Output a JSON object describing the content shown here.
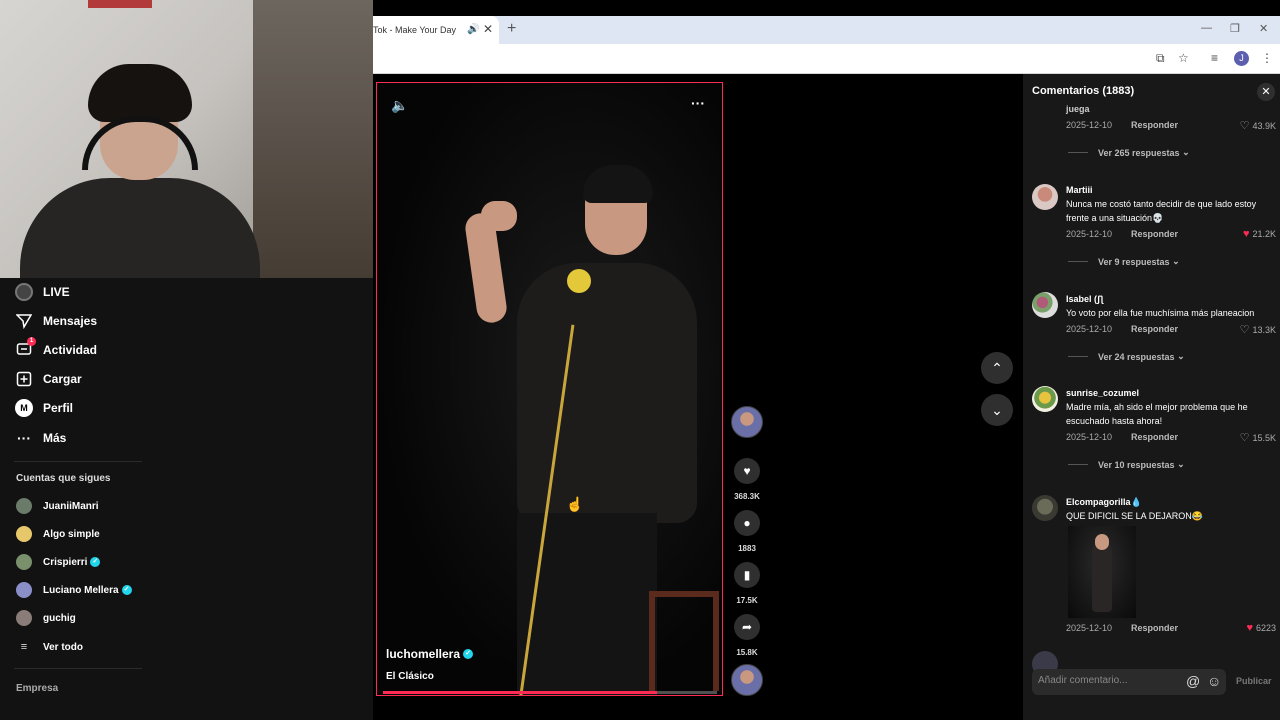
{
  "browser": {
    "tab_title": "Tok - Make Your Day",
    "profile_initial": "J"
  },
  "sidebar": {
    "items": [
      {
        "label": "LIVE",
        "icon": "live-icon"
      },
      {
        "label": "Mensajes",
        "icon": "paper-plane-icon"
      },
      {
        "label": "Actividad",
        "icon": "inbox-icon",
        "badge": "1"
      },
      {
        "label": "Cargar",
        "icon": "upload-icon"
      },
      {
        "label": "Perfil",
        "icon": "profile-icon"
      },
      {
        "label": "Más",
        "icon": "more-icon"
      }
    ],
    "following_title": "Cuentas que sigues",
    "following": [
      {
        "name": "JuaniiManri",
        "verified": false,
        "color": "#6b7b6a"
      },
      {
        "name": "Algo simple",
        "verified": false,
        "color": "#e6c86a"
      },
      {
        "name": "Crispierri",
        "verified": true,
        "color": "#7a8f6c"
      },
      {
        "name": "Luciano Mellera",
        "verified": true,
        "color": "#8b8fc8"
      },
      {
        "name": "guchig",
        "verified": false,
        "color": "#8a7c78"
      }
    ],
    "see_all": "Ver todo",
    "footer_label": "Empresa"
  },
  "video": {
    "username": "luchomellera",
    "description": "El Clásico",
    "progress": 0.82
  },
  "actions": {
    "likes": "368.3K",
    "comments": "1883",
    "saves": "17.5K",
    "shares": "15.8K"
  },
  "comments_panel": {
    "title": "Comentarios",
    "count": "(1883)",
    "top_partial_name": "juega",
    "comments": [
      {
        "name": "",
        "text": "",
        "date": "2025-12-10",
        "reply": "Responder",
        "likes": "43.9K",
        "liked": false,
        "more": "Ver 265 respuestas"
      },
      {
        "name": "Martiii",
        "text": "Nunca me costó tanto decidir de que lado estoy frente a una situación💀",
        "date": "2025-12-10",
        "reply": "Responder",
        "likes": "21.2K",
        "liked": true,
        "more": "Ver 9 respuestas"
      },
      {
        "name": "Isabel (ʃƪ",
        "text": "Yo voto por ella fue muchísima más planeacion",
        "date": "2025-12-10",
        "reply": "Responder",
        "likes": "13.3K",
        "liked": false,
        "more": "Ver 24 respuestas"
      },
      {
        "name": "sunrise_cozumel",
        "text": "Madre mía, ah sido el mejor problema que he escuchado hasta ahora!",
        "date": "2025-12-10",
        "reply": "Responder",
        "likes": "15.5K",
        "liked": false,
        "more": "Ver 10 respuestas"
      },
      {
        "name": "Elcompagorilla💧",
        "text": "QUE DIFICIL SE LA DEJARON😂",
        "date": "2025-12-10",
        "reply": "Responder",
        "likes": "6223",
        "liked": true,
        "more": ""
      }
    ],
    "input_placeholder": "Añadir comentario...",
    "post_label": "Publicar"
  }
}
